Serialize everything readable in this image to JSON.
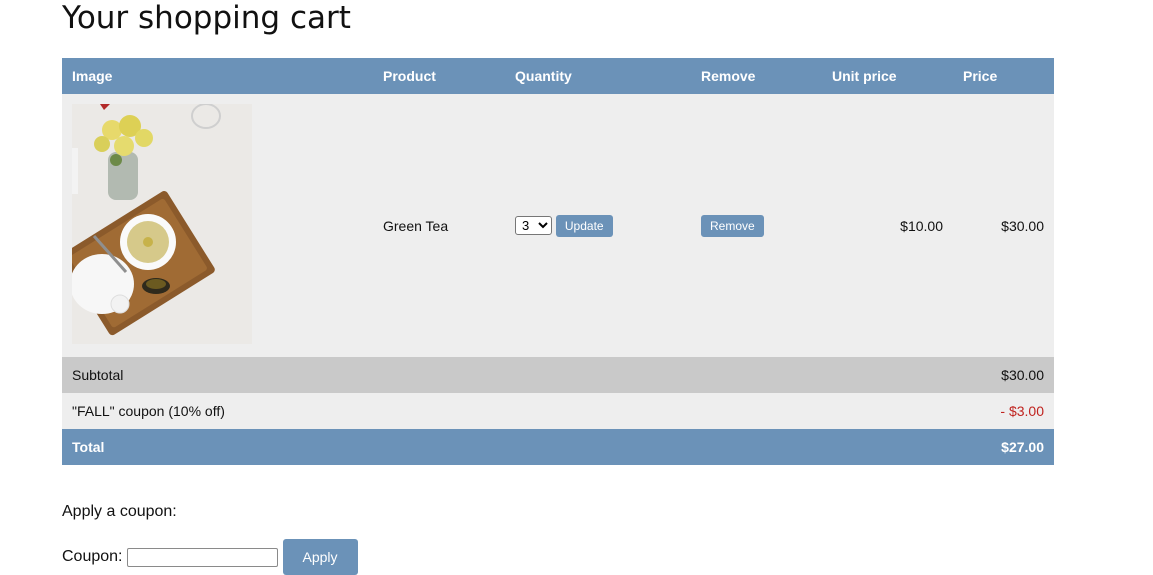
{
  "page": {
    "title": "Your shopping cart"
  },
  "table": {
    "headers": {
      "image": "Image",
      "product": "Product",
      "quantity": "Quantity",
      "remove": "Remove",
      "unit_price": "Unit price",
      "price": "Price"
    },
    "items": [
      {
        "product": "Green Tea",
        "quantity_selected": "3",
        "update_label": "Update",
        "remove_label": "Remove",
        "unit_price": "$10.00",
        "price": "$30.00"
      }
    ],
    "subtotal": {
      "label": "Subtotal",
      "value": "$30.00"
    },
    "coupon": {
      "label": "\"FALL\" coupon (10% off)",
      "value": "- $3.00"
    },
    "total": {
      "label": "Total",
      "value": "$27.00"
    }
  },
  "coupon_form": {
    "heading": "Apply a coupon:",
    "field_label": "Coupon:",
    "input_value": "",
    "apply_label": "Apply"
  },
  "colors": {
    "accent": "#6b92b8",
    "row_bg": "#eeeeee",
    "subtotal_bg": "#c9c9c9",
    "discount": "#c0231f"
  }
}
